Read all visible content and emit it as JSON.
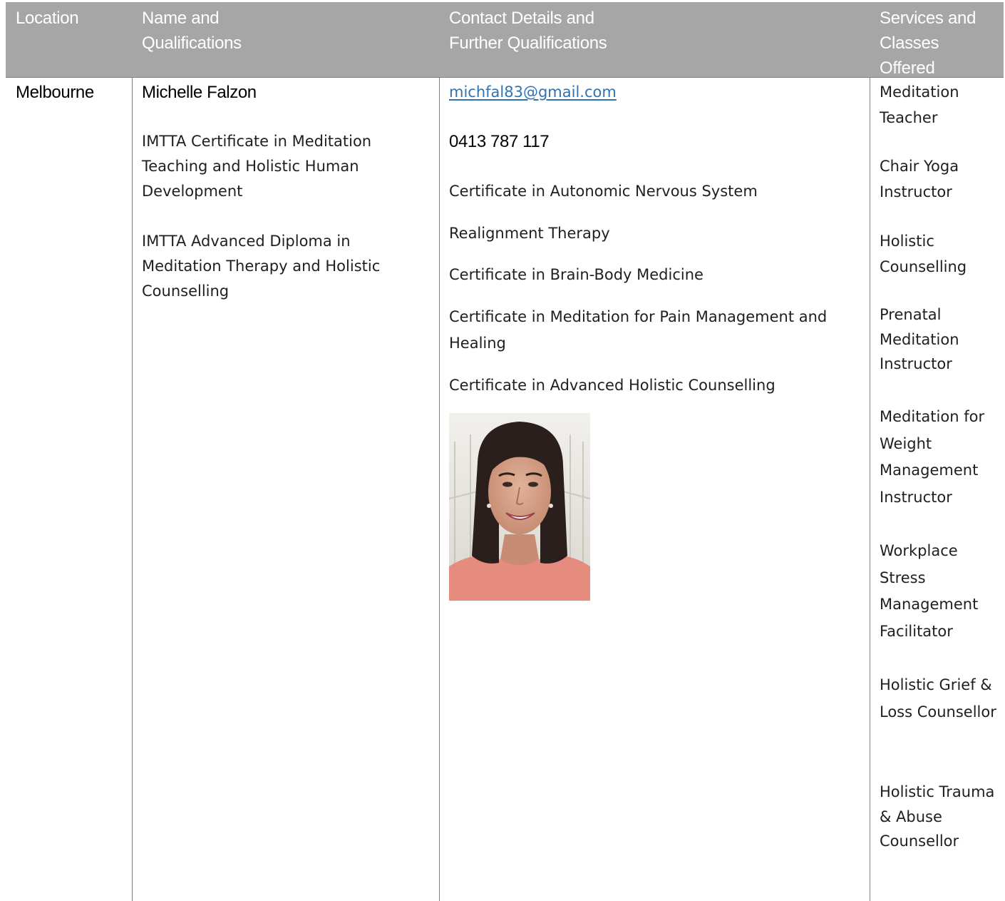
{
  "table": {
    "headers": {
      "location": "Location",
      "name": "Name and\nQualifications",
      "contact": "Contact Details and\nFurther Qualifications",
      "services": "Services and\nClasses\nOffered"
    },
    "row": {
      "location": "Melbourne",
      "name": "Michelle Falzon",
      "qualifications": [
        "IMTTA Certificate in Meditation Teaching and Holistic Human Development",
        "IMTTA Advanced Diploma in Meditation Therapy and Holistic Counselling"
      ],
      "email": "michfal83@gmail.com",
      "phone": "0413 787 117",
      "further_qualifications": [
        "Certificate in Autonomic Nervous System",
        "Realignment Therapy",
        "Certificate in Brain-Body Medicine",
        "Certificate in Meditation for Pain Management and Healing",
        "Certificate in Advanced Holistic Counselling"
      ],
      "services": [
        "Meditation Teacher",
        "Chair Yoga Instructor",
        "Holistic Counselling",
        "Prenatal Meditation Instructor",
        "Meditation for Weight Management Instructor",
        "Workplace Stress Management Facilitator",
        "Holistic Grief & Loss Counsellor",
        "Holistic Trauma & Abuse Counsellor"
      ]
    }
  },
  "colors": {
    "header_bg": "#a6a6a6",
    "header_text": "#ffffff",
    "link": "#2e74b5",
    "grid": "#808080"
  },
  "icons": {
    "photo": "portrait-photo"
  }
}
